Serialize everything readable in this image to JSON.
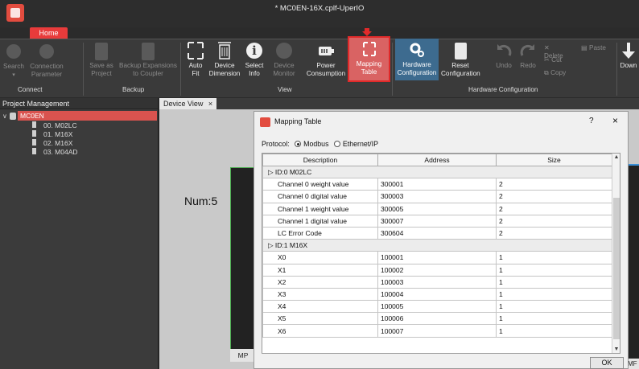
{
  "window": {
    "title": "* MC0EN-16X.cplf-UperIO"
  },
  "ribbon": {
    "home_tab": "Home",
    "buttons": {
      "search": "Search",
      "connection_parameter_1": "Connection",
      "connection_parameter_2": "Parameter",
      "save_as_project_1": "Save as",
      "save_as_project_2": "Project",
      "backup_expansions_1": "Backup Expansions",
      "backup_expansions_2": "to Coupler",
      "auto_fit_1": "Auto",
      "auto_fit_2": "Fit",
      "device_dimension_1": "Device",
      "device_dimension_2": "Dimension",
      "select_info_1": "Select",
      "select_info_2": "Info",
      "device_monitor_1": "Device",
      "device_monitor_2": "Monitor",
      "power_consumption_1": "Power",
      "power_consumption_2": "Consumption",
      "mapping_table_1": "Mapping",
      "mapping_table_2": "Table",
      "hardware_configuration_1": "Hardware",
      "hardware_configuration_2": "Configuration",
      "reset_configuration_1": "Reset",
      "reset_configuration_2": "Configuration",
      "undo": "Undo",
      "redo": "Redo",
      "delete": "Delete",
      "paste": "Paste",
      "cut": "Cut",
      "copy": "Copy",
      "download": "Down"
    },
    "groups": {
      "connect": "Connect",
      "backup": "Backup",
      "view": "View",
      "hardware_configuration": "Hardware Configuration"
    }
  },
  "project_panel": {
    "header": "Project Management",
    "root": "MC0EN",
    "items": [
      "00. M02LC",
      "01. M16X",
      "02. M16X",
      "03. M04AD"
    ]
  },
  "device_view": {
    "tab": "Device View",
    "num_label": "Num:5",
    "module_label": "MP",
    "right_module_label": "MF"
  },
  "dialog": {
    "title": "Mapping Table",
    "help": "?",
    "close": "×",
    "protocol_label": "Protocol:",
    "protocol_options": [
      "Modbus",
      "Ethernet/IP"
    ],
    "protocol_selected": "Modbus",
    "columns": [
      "Description",
      "Address",
      "Size"
    ],
    "groups": [
      {
        "name": "ID:0 M02LC",
        "rows": [
          [
            "Channel 0 weight value",
            "300001",
            "2"
          ],
          [
            "Channel 0 digital value",
            "300003",
            "2"
          ],
          [
            "Channel 1 weight value",
            "300005",
            "2"
          ],
          [
            "Channel 1 digital value",
            "300007",
            "2"
          ],
          [
            "LC Error Code",
            "300604",
            "2"
          ]
        ]
      },
      {
        "name": "ID:1 M16X",
        "rows": [
          [
            "X0",
            "100001",
            "1"
          ],
          [
            "X1",
            "100002",
            "1"
          ],
          [
            "X2",
            "100003",
            "1"
          ],
          [
            "X3",
            "100004",
            "1"
          ],
          [
            "X4",
            "100005",
            "1"
          ],
          [
            "X5",
            "100006",
            "1"
          ],
          [
            "X6",
            "100007",
            "1"
          ]
        ]
      }
    ],
    "ok_label": "OK"
  }
}
